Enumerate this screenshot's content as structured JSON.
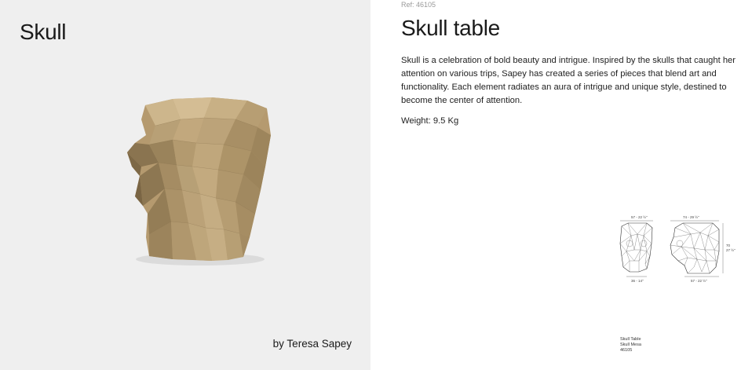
{
  "left": {
    "title": "Skull",
    "designer": "by Teresa Sapey"
  },
  "product": {
    "ref": "Ref: 46105",
    "title": "Skull table",
    "description": "Skull is a celebration of bold beauty and intrigue. Inspired by the skulls that caught her attention on various trips, Sapey has created a series of pieces that blend art and functionality. Each element radiates an aura of intrigue and unique style, destined to become the center of attention.",
    "weight": "Weight: 9.5 Kg"
  },
  "drawing": {
    "front_top_dim": "57 - 22 ½\"",
    "front_bottom_dim": "36 - 14\"",
    "side_top_dim": "74 - 29 ½\"",
    "side_bottom_dim": "57 - 22 ½\"",
    "height_dim_cm": "70",
    "height_dim_in": "27 ½\""
  },
  "caption": {
    "line1": "Skull Table",
    "line2": "Skull Mesa",
    "line3": "46105"
  },
  "colors": {
    "left_background": "#efefef",
    "skull_tan": "#b59a6f"
  }
}
